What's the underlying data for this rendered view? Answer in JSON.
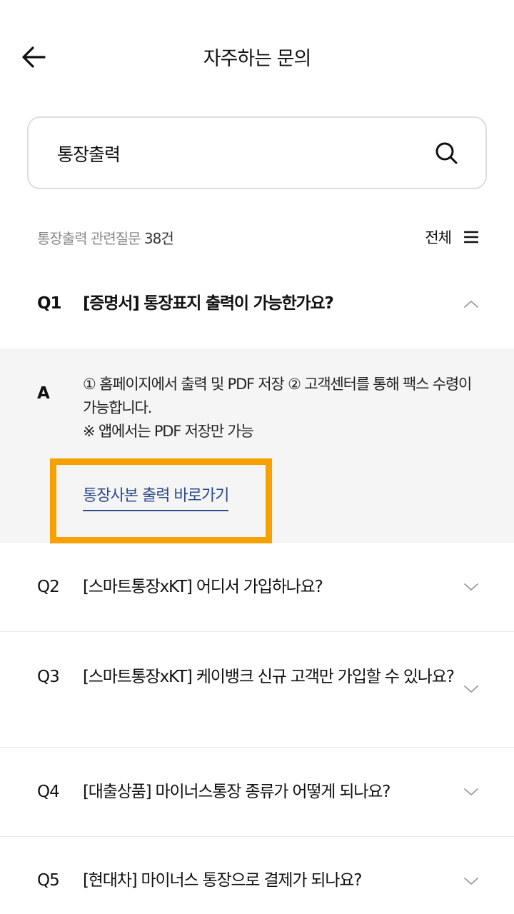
{
  "header": {
    "title": "자주하는 문의",
    "back_icon": "arrow-left-icon"
  },
  "search": {
    "value": "통장출력",
    "placeholder": "",
    "icon": "search-icon"
  },
  "results": {
    "summary_prefix": "통장출력 관련질문 ",
    "count": "38건",
    "filter_label": "전체",
    "filter_icon": "menu-icon"
  },
  "faqs": [
    {
      "num": "Q1",
      "question": "[증명서] 통장표지 출력이 가능한가요?",
      "expanded": true,
      "answer_label": "A",
      "answer_lines": [
        "① 홈페이지에서 출력 및 PDF 저장 ② 고객센터를 통해 팩스 수령이 가능합니다.",
        "※ 앱에서는 PDF 저장만 가능"
      ],
      "answer_link": "통장사본 출력 바로가기"
    },
    {
      "num": "Q2",
      "question": "[스마트통장xKT] 어디서 가입하나요?",
      "expanded": false
    },
    {
      "num": "Q3",
      "question": "[스마트통장xKT] 케이뱅크 신규 고객만 가입할 수 있나요?",
      "expanded": false
    },
    {
      "num": "Q4",
      "question": "[대출상품] 마이너스통장 종류가 어떻게 되나요?",
      "expanded": false
    },
    {
      "num": "Q5",
      "question": "[현대차] 마이너스 통장으로 결제가 되나요?",
      "expanded": false
    }
  ],
  "colors": {
    "highlight": "#f7a100",
    "link": "#2d4a8a",
    "answer_bg": "#f5f5f5"
  }
}
